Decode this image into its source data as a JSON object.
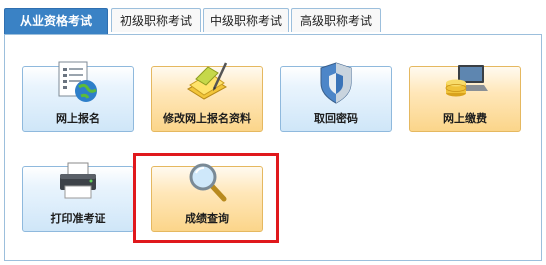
{
  "tabs": [
    {
      "label": "从业资格考试",
      "active": true
    },
    {
      "label": "初级职称考试",
      "active": false
    },
    {
      "label": "中级职称考试",
      "active": false
    },
    {
      "label": "高级职称考试",
      "active": false
    }
  ],
  "tiles": [
    {
      "label": "网上报名",
      "icon": "form-globe-icon",
      "style": "blue"
    },
    {
      "label": "修改网上报名资料",
      "icon": "edit-note-icon",
      "style": "orange"
    },
    {
      "label": "取回密码",
      "icon": "shield-icon",
      "style": "blue"
    },
    {
      "label": "网上缴费",
      "icon": "coins-laptop-icon",
      "style": "orange"
    },
    {
      "label": "打印准考证",
      "icon": "printer-icon",
      "style": "blue"
    },
    {
      "label": "成绩查询",
      "icon": "magnifier-icon",
      "style": "orange"
    }
  ],
  "colors": {
    "active_tab": "#3a82c5",
    "border": "#9cbfdc",
    "highlight": "#e0181c"
  }
}
